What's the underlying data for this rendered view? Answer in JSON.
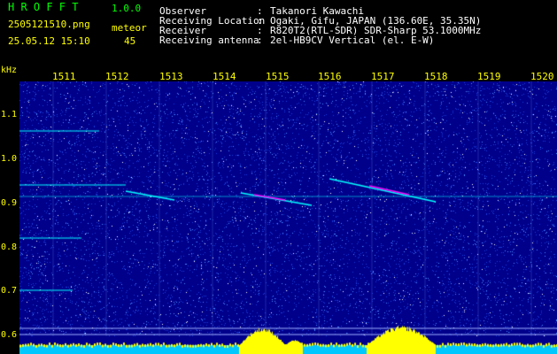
{
  "header": {
    "app_title": "H R O F F T",
    "version": "1.0.0",
    "filename": "2505121510.png",
    "datetime": "25.05.12 15:10",
    "meteor_label": "meteor",
    "meteor_count": "45",
    "fields": [
      {
        "label": "Observer",
        "value": "Takanori Kawachi"
      },
      {
        "label": "Receiving Location",
        "value": "Ogaki, Gifu, JAPAN (136.60E, 35.35N)"
      },
      {
        "label": "Receiver",
        "value": "R820T2(RTL-SDR) SDR-Sharp 53.1000MHz"
      },
      {
        "label": "Receiving antenna",
        "value": "2el-HB9CV Vertical (el. E-W)"
      }
    ]
  },
  "axis": {
    "y_unit": "kHz",
    "x_ticks": [
      "1511",
      "1512",
      "1513",
      "1514",
      "1515",
      "1516",
      "1517",
      "1518",
      "1519",
      "1520"
    ],
    "y_ticks": [
      "1.1",
      "1.0",
      "0.9",
      "0.8",
      "0.7",
      "0.6"
    ]
  },
  "colors": {
    "background": "#00008b",
    "noise": "#3a5fff",
    "signal": "#00ffff",
    "meteor": "#ff00ff",
    "level_bar": "#ffff00",
    "axis_text": "#ffff00"
  }
}
